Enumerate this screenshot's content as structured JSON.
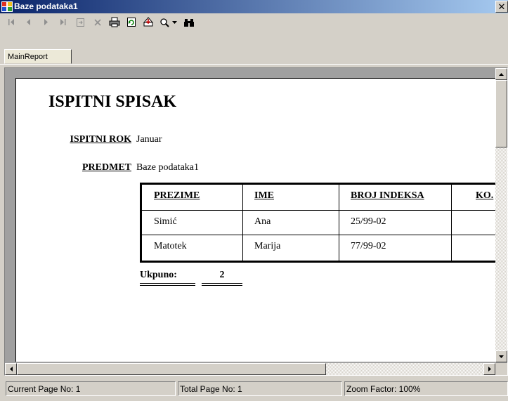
{
  "window": {
    "title": "Baze podataka1"
  },
  "toolbar": {
    "buttons": [
      {
        "icon": "first-page-icon"
      },
      {
        "icon": "previous-page-icon"
      },
      {
        "icon": "next-page-icon"
      },
      {
        "icon": "last-page-icon"
      },
      {
        "icon": "goto-page-icon"
      },
      {
        "icon": "stop-icon"
      },
      {
        "icon": "print-icon"
      },
      {
        "icon": "refresh-icon"
      },
      {
        "icon": "export-icon"
      },
      {
        "icon": "zoom-icon"
      },
      {
        "icon": "dropdown-arrow-icon"
      },
      {
        "icon": "search-binoculars-icon"
      }
    ]
  },
  "tabs": [
    {
      "label": "MainReport"
    }
  ],
  "report": {
    "title": "ISPITNI SPISAK",
    "rok_label": "ISPITNI ROK",
    "rok_value": "Januar",
    "predmet_label": "PREDMET",
    "predmet_value": "Baze podataka1",
    "columns": [
      "PREZIME",
      "IME",
      "BROJ INDEKSA",
      "KO."
    ],
    "rows": [
      [
        "Simić",
        "Ana",
        "25/99-02",
        ""
      ],
      [
        "Matotek",
        "Marija",
        "77/99-02",
        ""
      ]
    ],
    "total_label": "Ukpuno:",
    "total_value": "2"
  },
  "status": {
    "current_page": "Current Page No: 1",
    "total_page": "Total Page No: 1",
    "zoom": "Zoom Factor: 100%"
  },
  "colors": {
    "titlebar_start": "#0a246a",
    "titlebar_end": "#a6caf0",
    "chrome": "#d4d0c8",
    "viewer_bg": "#a0a0a0"
  }
}
